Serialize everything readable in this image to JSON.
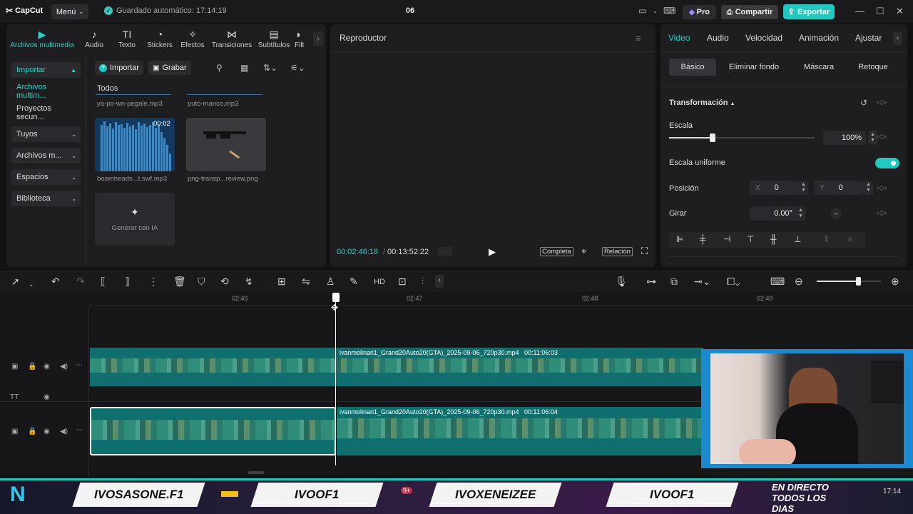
{
  "app": {
    "logo": "CapCut",
    "menu": "Menú",
    "autosave": "Guardado automático: 17:14:19",
    "project": "06",
    "pro": "Pro",
    "share": "Compartir",
    "export": "Exportar"
  },
  "media_tabs": [
    {
      "label": "Archivos multimedia",
      "icon": "media-icon"
    },
    {
      "label": "Audio",
      "icon": "audio-icon"
    },
    {
      "label": "Texto",
      "icon": "text-icon"
    },
    {
      "label": "Stickers",
      "icon": "stickers-icon"
    },
    {
      "label": "Efectos",
      "icon": "effects-icon"
    },
    {
      "label": "Transiciones",
      "icon": "transitions-icon"
    },
    {
      "label": "Subtítulos",
      "icon": "subtitles-icon"
    },
    {
      "label": "Filt",
      "icon": "filters-icon"
    }
  ],
  "sidebar": [
    {
      "label": "Importar"
    },
    {
      "label": "Archivos multim..."
    },
    {
      "label": "Proyectos secun..."
    },
    {
      "label": "Tuyos"
    },
    {
      "label": "Archivos m..."
    },
    {
      "label": "Espacios"
    },
    {
      "label": "Biblioteca"
    }
  ],
  "media_toolbar": {
    "import": "Importar",
    "record": "Grabar",
    "filter_all": "Todos"
  },
  "media_items": [
    {
      "name": "ya-po-wn-pegale.mp3"
    },
    {
      "name": "puto-manco.mp3"
    },
    {
      "name": "boomheads...t.swf.mp3",
      "duration": "00:02"
    },
    {
      "name": "png-transp...review.png"
    },
    {
      "name": "Generar con IA"
    }
  ],
  "player": {
    "title": "Reproductor",
    "current": "00:02:46:18",
    "total": "00:13:52:22",
    "full_label": "Completa",
    "ratio_label": "Relación"
  },
  "props": {
    "tabs": [
      "Video",
      "Audio",
      "Velocidad",
      "Animación",
      "Ajustar"
    ],
    "subtabs": [
      "Básico",
      "Eliminar fondo",
      "Máscara",
      "Retoque"
    ],
    "section": "Transformación",
    "scale_label": "Escala",
    "scale_value": "100%",
    "scale_level": 0.3,
    "uniform_label": "Escala uniforme",
    "uniform_on": true,
    "position_label": "Posición",
    "x_label": "X",
    "x_value": "0",
    "y_label": "Y",
    "y_value": "0",
    "rotate_label": "Girar",
    "rotate_value": "0.00°"
  },
  "timeline": {
    "ticks": [
      "02:46",
      "02:47",
      "02:48",
      "02:49"
    ],
    "clip1": {
      "name": "ivanmolinari1_Grand20Auto20(GTA)_2025-09-06_720p30.mp4",
      "duration": "00:11:06:03"
    },
    "clip2": {
      "name": "ivanmolinari1_Grand20Auto20(GTA)_2025-09-06_720p30.mp4",
      "duration": "00:11:06:04"
    }
  },
  "banner": {
    "names": [
      "IVOSASONE.F1",
      "IVOOF1",
      "IVOXENEIZEE",
      "IVOOF1"
    ],
    "live": "EN DIRECTO TODOS LOS DIAS",
    "badge": "9+",
    "clock": "17:14"
  },
  "colors": {
    "accent": "#20c8c0",
    "panel": "#1e1e21",
    "bg": "#121214"
  }
}
